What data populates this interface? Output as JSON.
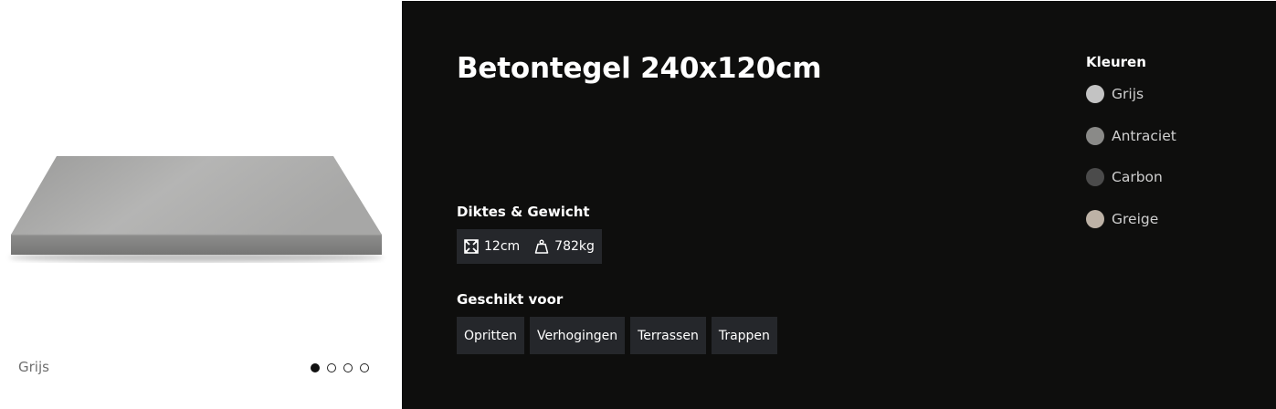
{
  "product": {
    "title": "Betontegel 240x120cm",
    "image_caption": "Grijs",
    "carousel": {
      "slide_count": 4,
      "active_index": 0
    }
  },
  "specs": {
    "label": "Diktes & Gewicht",
    "thickness": "12cm",
    "thickness_icon": "dimensions-icon",
    "weight": "782kg",
    "weight_icon": "weight-icon"
  },
  "suitable": {
    "label": "Geschikt voor",
    "tags": [
      "Opritten",
      "Verhogingen",
      "Terrassen",
      "Trappen"
    ]
  },
  "colors": {
    "label": "Kleuren",
    "items": [
      {
        "name": "Grijs",
        "hex": "#c3c3c3"
      },
      {
        "name": "Antraciet",
        "hex": "#8a8a88"
      },
      {
        "name": "Carbon",
        "hex": "#4b4b4b"
      },
      {
        "name": "Greige",
        "hex": "#bdb2a6"
      }
    ]
  },
  "theme": {
    "panel_bg": "#0e0e0d",
    "chip_bg": "#25272b"
  }
}
